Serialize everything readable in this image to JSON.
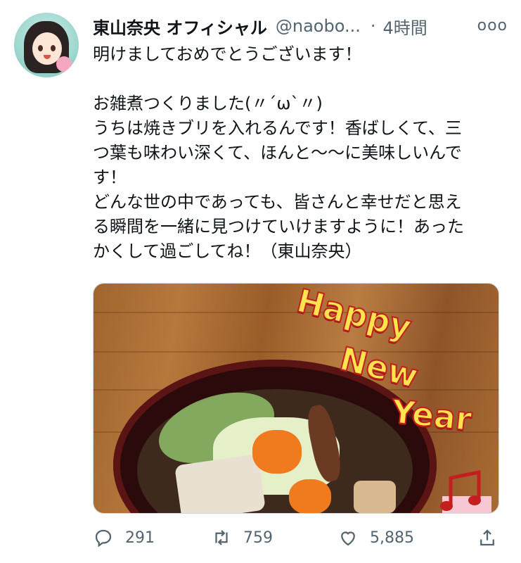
{
  "tweet": {
    "author_name": "東山奈央 オフィシャル",
    "handle": "@naobo...",
    "separator": "·",
    "time": "4時間",
    "more_icon": "ooo",
    "lines": [
      "明けましておめでとうございます！",
      "",
      "お雑煮つくりました(〃´ω`〃)",
      "うちは焼きブリを入れるんです！香ばしくて、三",
      "つ葉も味わい深くて、ほんと〜〜に美味しいんで",
      "す！",
      "どんな世の中であっても、皆さんと幸せだと思え",
      "る瞬間を一緒に見つけていけますように！あった",
      "かくして過ごしてね！（東山奈央）"
    ]
  },
  "media": {
    "overlay_words": [
      "Happy",
      "New",
      "Year"
    ]
  },
  "actions": {
    "reply": {
      "icon": "reply-icon",
      "count": "291"
    },
    "retweet": {
      "icon": "retweet-icon",
      "count": "759"
    },
    "like": {
      "icon": "heart-icon",
      "count": "5,885"
    },
    "share": {
      "icon": "share-icon"
    }
  },
  "colors": {
    "text": "#0f1419",
    "secondary": "#536471"
  }
}
